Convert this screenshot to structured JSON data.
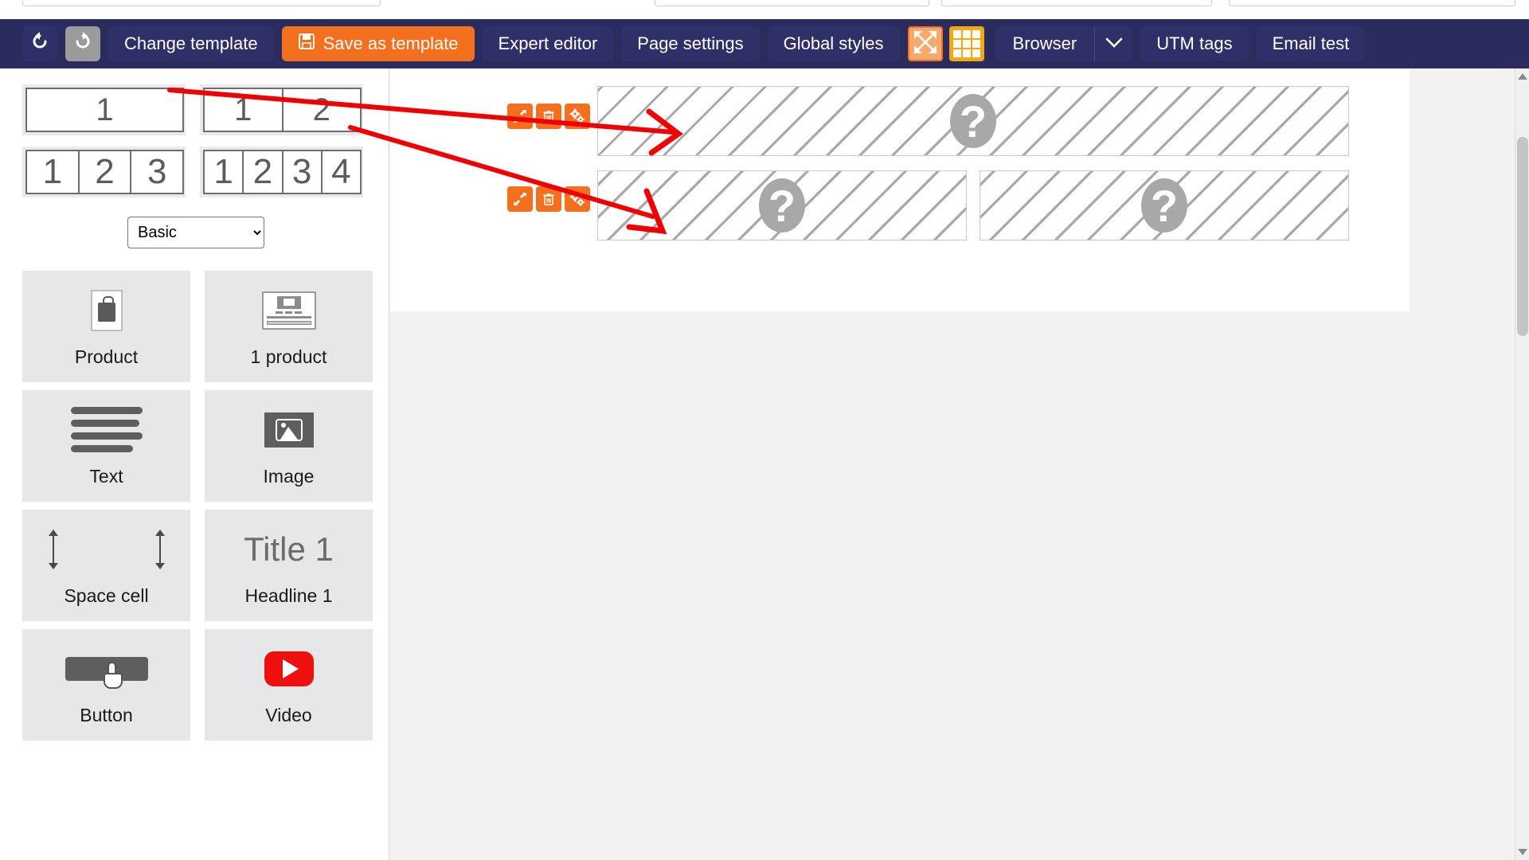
{
  "toolbar": {
    "undo_label": "undo-icon",
    "redo_label": "redo-icon",
    "change_template": "Change template",
    "save_as_template": "Save as template",
    "expert_editor": "Expert editor",
    "page_settings": "Page settings",
    "global_styles": "Global styles",
    "expand_icon": "expand-icon",
    "grid_icon": "grid-icon",
    "browser": "Browser",
    "browser_caret": "⌄",
    "utm_tags": "UTM tags",
    "email_test": "Email test",
    "colors": {
      "bar_bg": "#2b2c5e",
      "button_bg": "#2f3068",
      "accent_orange": "#f4701e",
      "grid_yellow": "#f3a712"
    }
  },
  "left_panel": {
    "templates": [
      {
        "name": "one-column",
        "cells": [
          "1"
        ]
      },
      {
        "name": "two-column",
        "cells": [
          "1",
          "2"
        ]
      },
      {
        "name": "three-column",
        "cells": [
          "1",
          "2",
          "3"
        ]
      },
      {
        "name": "four-column",
        "cells": [
          "1",
          "2",
          "3",
          "4"
        ]
      }
    ],
    "category_select": {
      "value": "Basic",
      "options": [
        "Basic"
      ]
    },
    "components": [
      {
        "label": "Product",
        "icon": "shopping-bag-icon"
      },
      {
        "label": "1 product",
        "icon": "product-card-icon"
      },
      {
        "label": "Text",
        "icon": "text-lines-icon"
      },
      {
        "label": "Image",
        "icon": "image-icon"
      },
      {
        "label": "Space cell",
        "icon": "vertical-resize-icon"
      },
      {
        "label": "Headline 1",
        "icon": "title-icon",
        "art_text": "Title 1"
      },
      {
        "label": "Button",
        "icon": "button-cursor-icon"
      },
      {
        "label": "Video",
        "icon": "youtube-play-icon"
      }
    ]
  },
  "canvas": {
    "rows": [
      {
        "name": "row-1",
        "tools": [
          "move-icon",
          "trash-icon",
          "settings-gears-icon"
        ],
        "blocks": [
          {
            "placeholder": "?"
          }
        ]
      },
      {
        "name": "row-2",
        "tools": [
          "move-icon",
          "trash-icon",
          "settings-gears-icon"
        ],
        "blocks": [
          {
            "placeholder": "?"
          },
          {
            "placeholder": "?"
          }
        ]
      }
    ],
    "placeholder_glyph": "?"
  }
}
